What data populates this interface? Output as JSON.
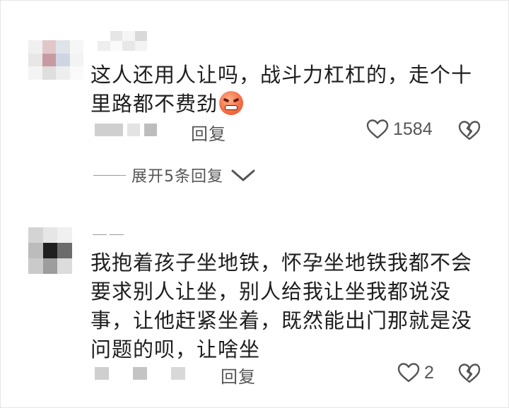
{
  "comments": [
    {
      "text": "这人还用人让吗，战斗力杠杠的，走个十里路都不费劲",
      "emoji_icon": "angry-face-icon",
      "reply_label": "回复",
      "like_count": "1584",
      "expand_replies_label": "展开5条回复"
    },
    {
      "name_text": "——",
      "text": "我抱着孩子坐地铁，怀孕坐地铁我都不会要求别人让坐，别人给我让坐我都说没事，让他赶紧坐着，既然能出门那就是没问题的呗，让啥坐",
      "reply_label": "回复",
      "like_count": "2"
    }
  ],
  "icons": {
    "like": "heart-outline-icon",
    "dislike": "broken-heart-icon",
    "expand": "chevron-down-icon"
  },
  "colors": {
    "text": "#1e1e1e",
    "meta": "#555555",
    "mosaic": "#c9c9c9",
    "emoji": "#f26b43"
  }
}
